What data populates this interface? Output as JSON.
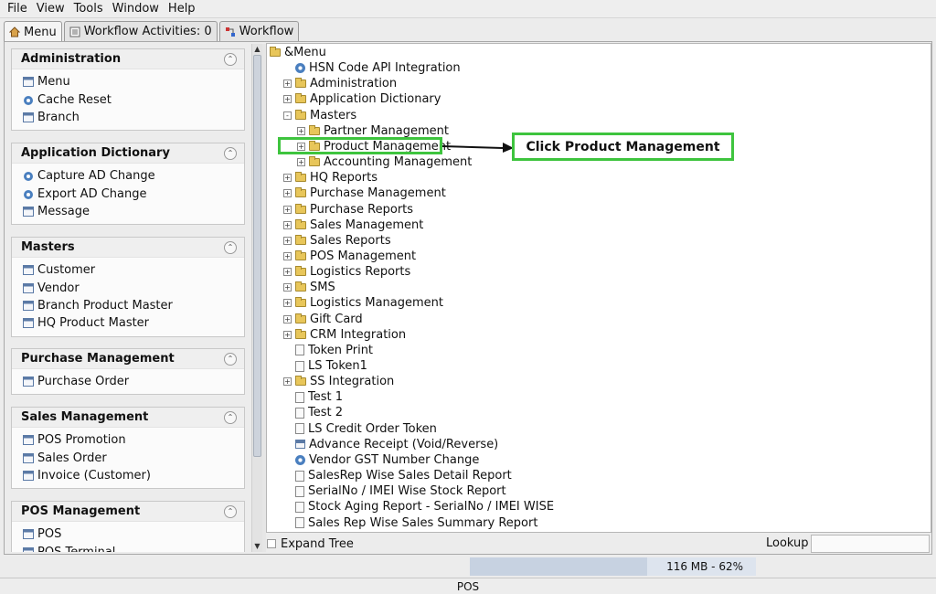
{
  "menubar": [
    "File",
    "View",
    "Tools",
    "Window",
    "Help"
  ],
  "tabs": [
    {
      "label": "Menu",
      "icon": "home-icon"
    },
    {
      "label": "Workflow Activities: 0",
      "icon": "list-icon"
    },
    {
      "label": "Workflow",
      "icon": "workflow-icon"
    }
  ],
  "groups": [
    {
      "title": "Administration",
      "items": [
        {
          "label": "Menu",
          "icon": "window-icon"
        },
        {
          "label": "Cache Reset",
          "icon": "process-gear-icon"
        },
        {
          "label": "Branch",
          "icon": "window-icon"
        }
      ]
    },
    {
      "title": "Application Dictionary",
      "items": [
        {
          "label": "Capture AD Change",
          "icon": "process-gear-icon"
        },
        {
          "label": "Export AD Change",
          "icon": "process-gear-icon"
        },
        {
          "label": "Message",
          "icon": "window-icon"
        }
      ]
    },
    {
      "title": "Masters",
      "items": [
        {
          "label": "Customer",
          "icon": "window-icon"
        },
        {
          "label": "Vendor",
          "icon": "window-icon"
        },
        {
          "label": "Branch Product Master",
          "icon": "window-icon"
        },
        {
          "label": "HQ Product Master",
          "icon": "window-icon"
        }
      ]
    },
    {
      "title": "Purchase Management",
      "items": [
        {
          "label": "Purchase Order",
          "icon": "window-icon"
        }
      ]
    },
    {
      "title": "Sales Management",
      "items": [
        {
          "label": "POS Promotion",
          "icon": "window-icon"
        },
        {
          "label": "Sales Order",
          "icon": "window-icon"
        },
        {
          "label": "Invoice (Customer)",
          "icon": "window-icon"
        }
      ]
    },
    {
      "title": "POS Management",
      "items": [
        {
          "label": "POS",
          "icon": "window-icon"
        },
        {
          "label": "POS Terminal",
          "icon": "window-icon"
        }
      ]
    }
  ],
  "tree": [
    {
      "label": "&Menu",
      "level": 0,
      "exp": "",
      "type": "folder-open"
    },
    {
      "label": "HSN Code API Integration",
      "level": 1,
      "exp": "",
      "type": "gear"
    },
    {
      "label": "Administration",
      "level": 1,
      "exp": "+",
      "type": "folder"
    },
    {
      "label": "Application Dictionary",
      "level": 1,
      "exp": "+",
      "type": "folder"
    },
    {
      "label": "Masters",
      "level": 1,
      "exp": "-",
      "type": "folder-open"
    },
    {
      "label": "Partner Management",
      "level": 2,
      "exp": "+",
      "type": "folder"
    },
    {
      "label": "Product Management",
      "level": 2,
      "exp": "+",
      "type": "folder"
    },
    {
      "label": "Accounting Management",
      "level": 2,
      "exp": "+",
      "type": "folder"
    },
    {
      "label": "HQ Reports",
      "level": 1,
      "exp": "+",
      "type": "folder"
    },
    {
      "label": "Purchase Management",
      "level": 1,
      "exp": "+",
      "type": "folder"
    },
    {
      "label": "Purchase Reports",
      "level": 1,
      "exp": "+",
      "type": "folder"
    },
    {
      "label": "Sales Management",
      "level": 1,
      "exp": "+",
      "type": "folder"
    },
    {
      "label": "Sales Reports",
      "level": 1,
      "exp": "+",
      "type": "folder"
    },
    {
      "label": "POS Management",
      "level": 1,
      "exp": "+",
      "type": "folder"
    },
    {
      "label": "Logistics Reports",
      "level": 1,
      "exp": "+",
      "type": "folder"
    },
    {
      "label": "SMS",
      "level": 1,
      "exp": "+",
      "type": "folder"
    },
    {
      "label": "Logistics Management",
      "level": 1,
      "exp": "+",
      "type": "folder"
    },
    {
      "label": "Gift Card",
      "level": 1,
      "exp": "+",
      "type": "folder"
    },
    {
      "label": "CRM Integration",
      "level": 1,
      "exp": "+",
      "type": "folder"
    },
    {
      "label": "Token Print",
      "level": 1,
      "exp": "",
      "type": "doc"
    },
    {
      "label": "LS Token1",
      "level": 1,
      "exp": "",
      "type": "doc"
    },
    {
      "label": "SS Integration",
      "level": 1,
      "exp": "+",
      "type": "folder"
    },
    {
      "label": "Test 1",
      "level": 1,
      "exp": "",
      "type": "doc"
    },
    {
      "label": "Test 2",
      "level": 1,
      "exp": "",
      "type": "doc"
    },
    {
      "label": "LS Credit Order Token",
      "level": 1,
      "exp": "",
      "type": "doc"
    },
    {
      "label": "Advance Receipt (Void/Reverse)",
      "level": 1,
      "exp": "",
      "type": "window"
    },
    {
      "label": "Vendor GST Number Change",
      "level": 1,
      "exp": "",
      "type": "gear"
    },
    {
      "label": "SalesRep Wise Sales Detail Report",
      "level": 1,
      "exp": "",
      "type": "doc"
    },
    {
      "label": "SerialNo / IMEI Wise Stock Report",
      "level": 1,
      "exp": "",
      "type": "doc"
    },
    {
      "label": "Stock Aging Report - SerialNo / IMEI WISE",
      "level": 1,
      "exp": "",
      "type": "doc"
    },
    {
      "label": "Sales Rep Wise Sales Summary Report",
      "level": 1,
      "exp": "",
      "type": "doc"
    }
  ],
  "annotation": {
    "callout": "Click Product Management",
    "color": "#3ec43e"
  },
  "footer": {
    "expand_tree": "Expand Tree",
    "lookup_label": "Lookup",
    "lookup_value": "",
    "memory": "116 MB - 62%",
    "memory_fraction": 0.62,
    "status": "POS"
  }
}
